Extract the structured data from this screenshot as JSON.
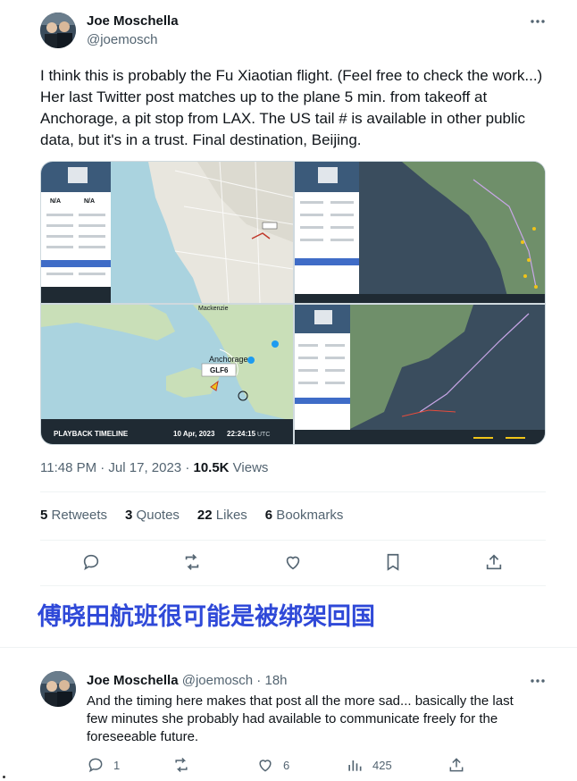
{
  "tweet": {
    "author_name": "Joe Moschella",
    "author_handle": "@joemosch",
    "text": "I think this is probably the Fu Xiaotian flight. (Feel free to check the work...) Her last Twitter post matches up to the plane 5 min. from takeoff at Anchorage, a pit stop from LAX. The US tail # is available in other public data, but it's in a trust. Final destination, Beijing.",
    "time": "11:48 PM · Jul 17, 2023 · ",
    "views_count": "10.5K",
    "views_label": " Views",
    "stats": {
      "retweets_count": "5",
      "retweets_label": " Retweets",
      "quotes_count": "3",
      "quotes_label": " Quotes",
      "likes_count": "22",
      "likes_label": " Likes",
      "bookmarks_count": "6",
      "bookmarks_label": " Bookmarks"
    }
  },
  "media": {
    "panel_na_1": "N/A",
    "panel_na_2": "N/A",
    "map_label_anchorage": "Anchorage",
    "callsign": "GLF6",
    "playback_title": "PLAYBACK TIMELINE",
    "playback_date": "10 Apr, 2023",
    "playback_time": "22:24:15",
    "playback_tz": "UTC",
    "map_label_top": "Mackenzie"
  },
  "banner_cn": "傅晓田航班很可能是被绑架回国",
  "reply": {
    "author_name": "Joe Moschella",
    "author_handle": "@joemosch · 18h",
    "text": "And the timing here makes that post all the more sad... basically the last few minutes she probably had available to communicate freely for the foreseeable future.",
    "reply_count": "1",
    "like_count": "6",
    "view_count": "425"
  },
  "colors": {
    "accent_text": "#2f49d8",
    "secondary_text": "#536471",
    "divider": "#eff3f4"
  },
  "icons": [
    "more-icon",
    "reply-icon",
    "retweet-icon",
    "like-icon",
    "bookmark-icon",
    "share-icon",
    "views-icon"
  ]
}
